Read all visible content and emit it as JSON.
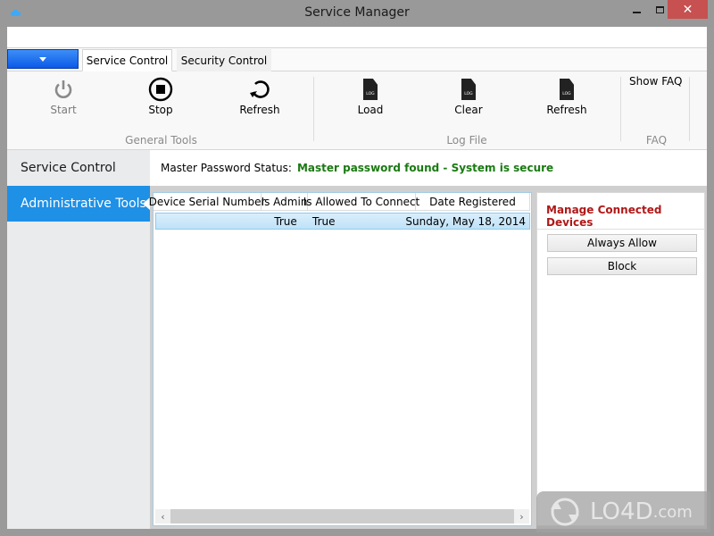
{
  "window": {
    "title": "Service Manager",
    "icon": "android-icon",
    "controls": {
      "minimize": "minimize-icon",
      "maximize": "maximize-icon",
      "close": "close-icon"
    }
  },
  "ribbon": {
    "app_menu": {
      "icon": "dropdown-triangle-icon"
    },
    "tabs": [
      {
        "label": "Service Control",
        "active": true
      },
      {
        "label": "Security Control",
        "active": false
      }
    ],
    "groups": [
      {
        "label": "General Tools",
        "buttons": [
          {
            "label": "Start",
            "icon": "power-icon",
            "enabled": false
          },
          {
            "label": "Stop",
            "icon": "stop-circle-icon",
            "enabled": true
          },
          {
            "label": "Refresh",
            "icon": "refresh-icon",
            "enabled": true
          }
        ]
      },
      {
        "label": "Log File",
        "buttons": [
          {
            "label": "Load",
            "icon": "log-file-icon",
            "icon_text": "LOG",
            "enabled": true
          },
          {
            "label": "Clear",
            "icon": "log-file-icon",
            "icon_text": "LOG",
            "enabled": true
          },
          {
            "label": "Refresh",
            "icon": "log-file-icon",
            "icon_text": "LOG",
            "enabled": true
          }
        ]
      },
      {
        "label": "FAQ",
        "buttons": [
          {
            "label": "Show FAQ",
            "enabled": true
          }
        ]
      }
    ]
  },
  "sidebar": {
    "items": [
      {
        "label": "Service Control",
        "selected": false
      },
      {
        "label": "Administrative Tools",
        "selected": true
      }
    ]
  },
  "status": {
    "label": "Master Password Status:",
    "value": "Master password found - System is secure",
    "value_color": "#1a7a12"
  },
  "devices_grid": {
    "columns": [
      "Device Serial Number",
      "Is Admin",
      "Is Allowed To Connect",
      "Date Registered"
    ],
    "rows": [
      {
        "serial": "",
        "is_admin": "True",
        "is_allowed": "True",
        "date_registered": "Sunday, May 18, 2014",
        "selected": true
      }
    ],
    "scroll_left": "‹",
    "scroll_right": "›"
  },
  "manage_panel": {
    "title": "Manage Connected Devices",
    "title_color": "#b01818",
    "buttons": [
      "Always Allow",
      "Block"
    ]
  },
  "watermark": {
    "text": "LO4D",
    "suffix": ".com"
  }
}
